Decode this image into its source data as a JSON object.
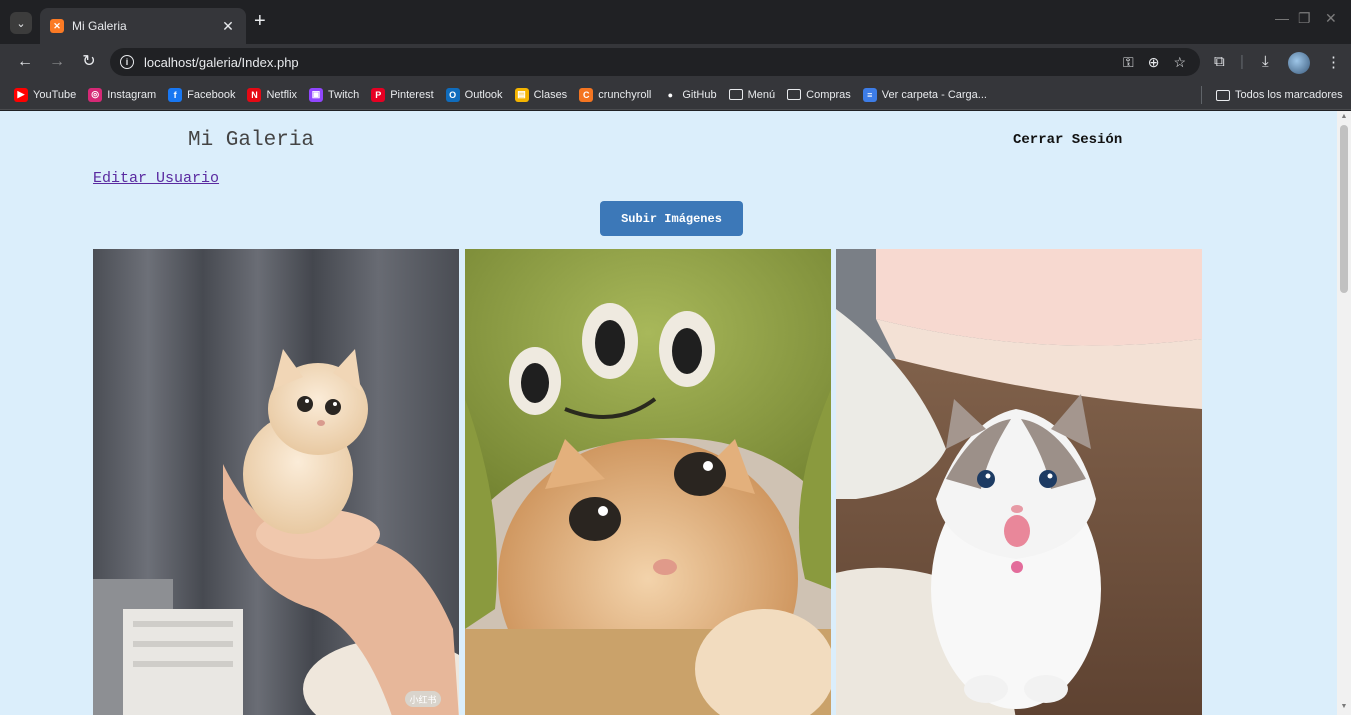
{
  "browser": {
    "tab_title": "Mi Galeria",
    "url": "localhost/galeria/Index.php",
    "bookmarks": [
      {
        "label": "YouTube",
        "icon": "youtube-icon",
        "color": "#ff0000"
      },
      {
        "label": "Instagram",
        "icon": "instagram-icon",
        "color": "#d62976"
      },
      {
        "label": "Facebook",
        "icon": "facebook-icon",
        "color": "#1877f2"
      },
      {
        "label": "Netflix",
        "icon": "netflix-icon",
        "color": "#e50914"
      },
      {
        "label": "Twitch",
        "icon": "twitch-icon",
        "color": "#9146ff"
      },
      {
        "label": "Pinterest",
        "icon": "pinterest-icon",
        "color": "#e60023"
      },
      {
        "label": "Outlook",
        "icon": "outlook-icon",
        "color": "#0f6cbd"
      },
      {
        "label": "Clases",
        "icon": "classroom-icon",
        "color": "#f4b400"
      },
      {
        "label": "crunchyroll",
        "icon": "crunchyroll-icon",
        "color": "#f47521"
      },
      {
        "label": "GitHub",
        "icon": "github-icon",
        "color": "#ffffff"
      },
      {
        "label": "Menú",
        "icon": "folder-icon",
        "color": ""
      },
      {
        "label": "Compras",
        "icon": "folder-icon",
        "color": ""
      },
      {
        "label": "Ver carpeta - Carga...",
        "icon": "forms-icon",
        "color": "#3d7de8"
      }
    ],
    "all_bookmarks": "Todos los marcadores"
  },
  "page": {
    "title": "Mi Galeria",
    "logout": "Cerrar Sesión",
    "edit_user": "Editar Usuario",
    "upload_button": "Subir Imágenes",
    "background": "#dbeefb",
    "accent": "#3c78b8",
    "photo_watermark": "小红书"
  }
}
